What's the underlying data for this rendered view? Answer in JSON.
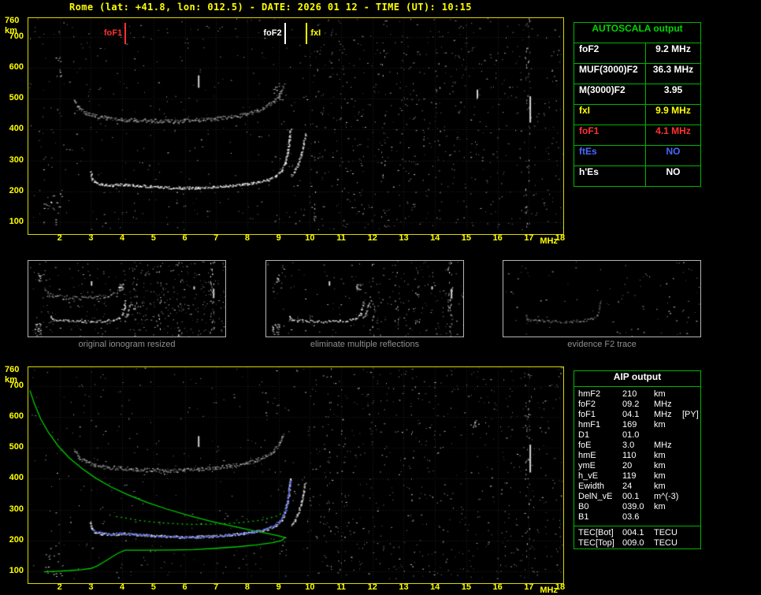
{
  "title": "Rome (lat: +41.8, lon: 012.5) - DATE: 2026 01 12 - TIME (UT): 10:15",
  "colors": {
    "accent_yellow": "#ffff00",
    "table_green": "#00b400",
    "title_green": "#00d800",
    "red": "#ff3232",
    "blue": "#4868ff",
    "white": "#ffffff",
    "profile_green": "#00cc00",
    "caption_gray": "#8f8f8f"
  },
  "autoscala": {
    "title": "AUTOSCALA output",
    "rows": [
      {
        "label": "foF2",
        "value": "9.2 MHz",
        "color": "#ffffff"
      },
      {
        "label": "MUF(3000)F2",
        "value": "36.3 MHz",
        "color": "#ffffff"
      },
      {
        "label": "M(3000)F2",
        "value": "3.95",
        "color": "#ffffff"
      },
      {
        "label": "fxI",
        "value": "9.9 MHz",
        "color": "#ffff00"
      },
      {
        "label": "foF1",
        "value": "4.1 MHz",
        "color": "#ff3232"
      },
      {
        "label": "ftEs",
        "value": "NO",
        "color": "#4868ff"
      },
      {
        "label": "h'Es",
        "value": "NO",
        "color": "#ffffff"
      }
    ]
  },
  "thumbnails": [
    {
      "caption": "original ionogram resized"
    },
    {
      "caption": "eliminate multiple reflections"
    },
    {
      "caption": "evidence F2 trace"
    }
  ],
  "aip": {
    "title": "AIP output",
    "rows": [
      {
        "label": "hmF2",
        "value": "210",
        "unit": "km",
        "extra": ""
      },
      {
        "label": "foF2",
        "value": "09.2",
        "unit": "MHz",
        "extra": ""
      },
      {
        "label": "foF1",
        "value": "04.1",
        "unit": "MHz",
        "extra": "[PY]"
      },
      {
        "label": "hmF1",
        "value": "169",
        "unit": "km",
        "extra": ""
      },
      {
        "label": "D1",
        "value": "01.0",
        "unit": "",
        "extra": ""
      },
      {
        "label": "foE",
        "value": "3.0",
        "unit": "MHz",
        "extra": ""
      },
      {
        "label": "hmE",
        "value": "110",
        "unit": "km",
        "extra": ""
      },
      {
        "label": "ymE",
        "value": "20",
        "unit": "km",
        "extra": ""
      },
      {
        "label": "h_vE",
        "value": "119",
        "unit": "km",
        "extra": ""
      },
      {
        "label": "Ewidth",
        "value": "24",
        "unit": "km",
        "extra": ""
      },
      {
        "label": "DelN_vE",
        "value": "00.1",
        "unit": "m^(-3)",
        "extra": ""
      },
      {
        "label": "B0",
        "value": "039.0",
        "unit": "km",
        "extra": ""
      },
      {
        "label": "B1",
        "value": "03.6",
        "unit": "",
        "extra": ""
      }
    ],
    "tec_rows": [
      {
        "label": "TEC[Bot]",
        "value": "004.1",
        "unit": "TECU"
      },
      {
        "label": "TEC[Top]",
        "value": "009.0",
        "unit": "TECU"
      }
    ]
  },
  "chart_data": [
    {
      "id": "top-ionogram",
      "type": "scatter",
      "xlabel": "MHz",
      "ylabel": "km",
      "xlim": [
        1.0,
        18.1
      ],
      "ylim": [
        75,
        760
      ],
      "x_ticks": [
        2,
        3,
        4,
        5,
        6,
        7,
        8,
        9,
        10,
        11,
        12,
        13,
        14,
        15,
        16,
        17,
        18
      ],
      "y_ticks": [
        700,
        600,
        500,
        400,
        300,
        200,
        100
      ],
      "y_max_label": "760",
      "grid": true,
      "markers": [
        {
          "label": "foF1",
          "freq": 4.1,
          "color": "#ff3232",
          "align": "right"
        },
        {
          "label": "foF2",
          "freq": 9.2,
          "color": "#ffffff",
          "align": "right"
        },
        {
          "label": "fxI",
          "freq": 9.9,
          "color": "#ffff00",
          "align": "left"
        }
      ],
      "traces": {
        "first_order": [
          [
            2.98,
            262
          ],
          [
            3.03,
            240
          ],
          [
            3.12,
            229
          ],
          [
            3.35,
            223
          ],
          [
            3.7,
            221
          ],
          [
            4.05,
            223
          ],
          [
            4.45,
            220
          ],
          [
            4.9,
            217
          ],
          [
            5.4,
            214
          ],
          [
            5.9,
            212
          ],
          [
            6.4,
            213
          ],
          [
            6.9,
            215
          ],
          [
            7.4,
            219
          ],
          [
            7.9,
            224
          ],
          [
            8.3,
            230
          ],
          [
            8.65,
            239
          ],
          [
            8.9,
            251
          ],
          [
            9.08,
            268
          ],
          [
            9.2,
            295
          ],
          [
            9.28,
            330
          ],
          [
            9.33,
            365
          ],
          [
            9.37,
            400
          ]
        ],
        "x_mode": [
          [
            9.4,
            252
          ],
          [
            9.5,
            265
          ],
          [
            9.6,
            287
          ],
          [
            9.7,
            318
          ],
          [
            9.78,
            352
          ],
          [
            9.84,
            385
          ]
        ],
        "second_order": [
          [
            2.45,
            495
          ],
          [
            2.6,
            470
          ],
          [
            2.82,
            455
          ],
          [
            3.1,
            445
          ],
          [
            3.5,
            438
          ],
          [
            3.95,
            434
          ],
          [
            4.45,
            431
          ],
          [
            4.95,
            429
          ],
          [
            5.45,
            428
          ],
          [
            5.95,
            429
          ],
          [
            6.45,
            432
          ],
          [
            6.95,
            436
          ],
          [
            7.45,
            442
          ],
          [
            7.95,
            451
          ],
          [
            8.3,
            461
          ],
          [
            8.6,
            475
          ],
          [
            8.85,
            494
          ],
          [
            9.02,
            516
          ],
          [
            9.13,
            540
          ]
        ]
      },
      "artifacts": [
        {
          "type": "dash",
          "f": 6.42,
          "km": 555,
          "len": 40
        },
        {
          "type": "dash",
          "f": 15.33,
          "km": 515,
          "len": 28
        },
        {
          "type": "dash",
          "f": 17.02,
          "km": 465,
          "len": 85
        },
        {
          "type": "cluster",
          "f": 9.0,
          "km": 525,
          "sf": 0.22,
          "sk": 28,
          "n": 16
        },
        {
          "type": "cluster",
          "f": 1.78,
          "km": 140,
          "sf": 0.3,
          "sk": 55,
          "n": 24
        },
        {
          "type": "cluster",
          "f": 1.95,
          "km": 605,
          "sf": 0.12,
          "sk": 35,
          "n": 9
        },
        {
          "type": "column",
          "f": 16.95,
          "n": 40
        },
        {
          "type": "column",
          "f": 12.35,
          "n": 14
        },
        {
          "type": "column",
          "f": 10.2,
          "n": 16
        },
        {
          "type": "column",
          "f": 14.1,
          "n": 10
        }
      ]
    },
    {
      "id": "bottom-ionogram",
      "type": "scatter",
      "xlabel": "MHz",
      "ylabel": "km",
      "xlim": [
        1.0,
        18.1
      ],
      "ylim": [
        75,
        760
      ],
      "x_ticks": [
        2,
        3,
        4,
        5,
        6,
        7,
        8,
        9,
        10,
        11,
        12,
        13,
        14,
        15,
        16,
        17,
        18
      ],
      "y_ticks": [
        700,
        600,
        500,
        400,
        300,
        200,
        100
      ],
      "y_max_label": "760",
      "grid": true,
      "traces": {
        "first_order": [
          [
            2.98,
            262
          ],
          [
            3.03,
            240
          ],
          [
            3.12,
            229
          ],
          [
            3.35,
            223
          ],
          [
            3.7,
            221
          ],
          [
            4.05,
            223
          ],
          [
            4.45,
            220
          ],
          [
            4.9,
            217
          ],
          [
            5.4,
            214
          ],
          [
            5.9,
            212
          ],
          [
            6.4,
            213
          ],
          [
            6.9,
            215
          ],
          [
            7.4,
            219
          ],
          [
            7.9,
            224
          ],
          [
            8.3,
            230
          ],
          [
            8.65,
            239
          ],
          [
            8.9,
            251
          ],
          [
            9.08,
            268
          ],
          [
            9.2,
            295
          ],
          [
            9.28,
            330
          ],
          [
            9.33,
            365
          ],
          [
            9.37,
            400
          ]
        ],
        "x_mode": [
          [
            9.4,
            252
          ],
          [
            9.5,
            265
          ],
          [
            9.6,
            287
          ],
          [
            9.7,
            318
          ],
          [
            9.78,
            352
          ],
          [
            9.84,
            385
          ]
        ],
        "second_order": [
          [
            2.45,
            495
          ],
          [
            2.6,
            470
          ],
          [
            2.82,
            455
          ],
          [
            3.1,
            445
          ],
          [
            3.5,
            438
          ],
          [
            3.95,
            434
          ],
          [
            4.45,
            431
          ],
          [
            4.95,
            429
          ],
          [
            5.45,
            428
          ],
          [
            5.95,
            429
          ],
          [
            6.45,
            432
          ],
          [
            6.95,
            436
          ],
          [
            7.45,
            442
          ],
          [
            7.95,
            451
          ],
          [
            8.3,
            461
          ],
          [
            8.6,
            475
          ],
          [
            8.85,
            494
          ],
          [
            9.02,
            516
          ],
          [
            9.13,
            540
          ]
        ]
      },
      "profile": [
        [
          1.05,
          685
        ],
        [
          1.2,
          640
        ],
        [
          1.4,
          592
        ],
        [
          1.65,
          548
        ],
        [
          1.95,
          506
        ],
        [
          2.3,
          468
        ],
        [
          2.7,
          434
        ],
        [
          3.15,
          402
        ],
        [
          3.65,
          373
        ],
        [
          4.2,
          347
        ],
        [
          4.8,
          323
        ],
        [
          5.45,
          301
        ],
        [
          6.15,
          280
        ],
        [
          6.85,
          262
        ],
        [
          7.55,
          246
        ],
        [
          8.2,
          232
        ],
        [
          8.7,
          222
        ],
        [
          9.05,
          214
        ],
        [
          9.2,
          210
        ],
        [
          9.1,
          200
        ],
        [
          8.8,
          193
        ],
        [
          8.3,
          186
        ],
        [
          7.7,
          180
        ],
        [
          7.0,
          175
        ],
        [
          6.3,
          171
        ],
        [
          5.6,
          169.5
        ],
        [
          4.9,
          169
        ],
        [
          4.1,
          169
        ],
        [
          3.9,
          161
        ],
        [
          3.7,
          149
        ],
        [
          3.45,
          133
        ],
        [
          3.2,
          118
        ],
        [
          3.0,
          110
        ],
        [
          2.7,
          106
        ],
        [
          2.3,
          103
        ],
        [
          1.9,
          101
        ],
        [
          1.5,
          99
        ]
      ],
      "profile_dotted": [
        [
          3.8,
          278
        ],
        [
          4.6,
          264
        ],
        [
          5.4,
          256
        ],
        [
          6.2,
          252
        ],
        [
          7.0,
          253
        ],
        [
          7.8,
          258
        ],
        [
          8.5,
          267
        ],
        [
          8.95,
          279
        ],
        [
          9.18,
          294
        ]
      ],
      "blue_trace": [
        [
          3.05,
          236
        ],
        [
          3.3,
          226
        ],
        [
          3.6,
          222
        ],
        [
          3.95,
          225
        ],
        [
          4.35,
          221
        ],
        [
          4.8,
          218
        ],
        [
          5.3,
          214
        ],
        [
          5.8,
          212
        ],
        [
          6.3,
          212
        ],
        [
          6.8,
          214
        ],
        [
          7.3,
          218
        ],
        [
          7.8,
          223
        ],
        [
          8.2,
          229
        ],
        [
          8.55,
          238
        ],
        [
          8.85,
          250
        ],
        [
          9.05,
          266
        ],
        [
          9.18,
          292
        ],
        [
          9.27,
          328
        ],
        [
          9.32,
          362
        ],
        [
          9.36,
          395
        ]
      ],
      "artifacts": [
        {
          "type": "dash",
          "f": 6.42,
          "km": 520,
          "len": 35
        },
        {
          "type": "dash",
          "f": 17.02,
          "km": 465,
          "len": 90
        },
        {
          "type": "cluster",
          "f": 1.78,
          "km": 135,
          "sf": 0.3,
          "sk": 50,
          "n": 20
        },
        {
          "type": "cluster",
          "f": 15.3,
          "km": 575,
          "sf": 0.1,
          "sk": 15,
          "n": 8
        },
        {
          "type": "column",
          "f": 16.95,
          "n": 36
        },
        {
          "type": "column",
          "f": 10.6,
          "n": 12
        },
        {
          "type": "column",
          "f": 13.3,
          "n": 10
        }
      ]
    }
  ]
}
